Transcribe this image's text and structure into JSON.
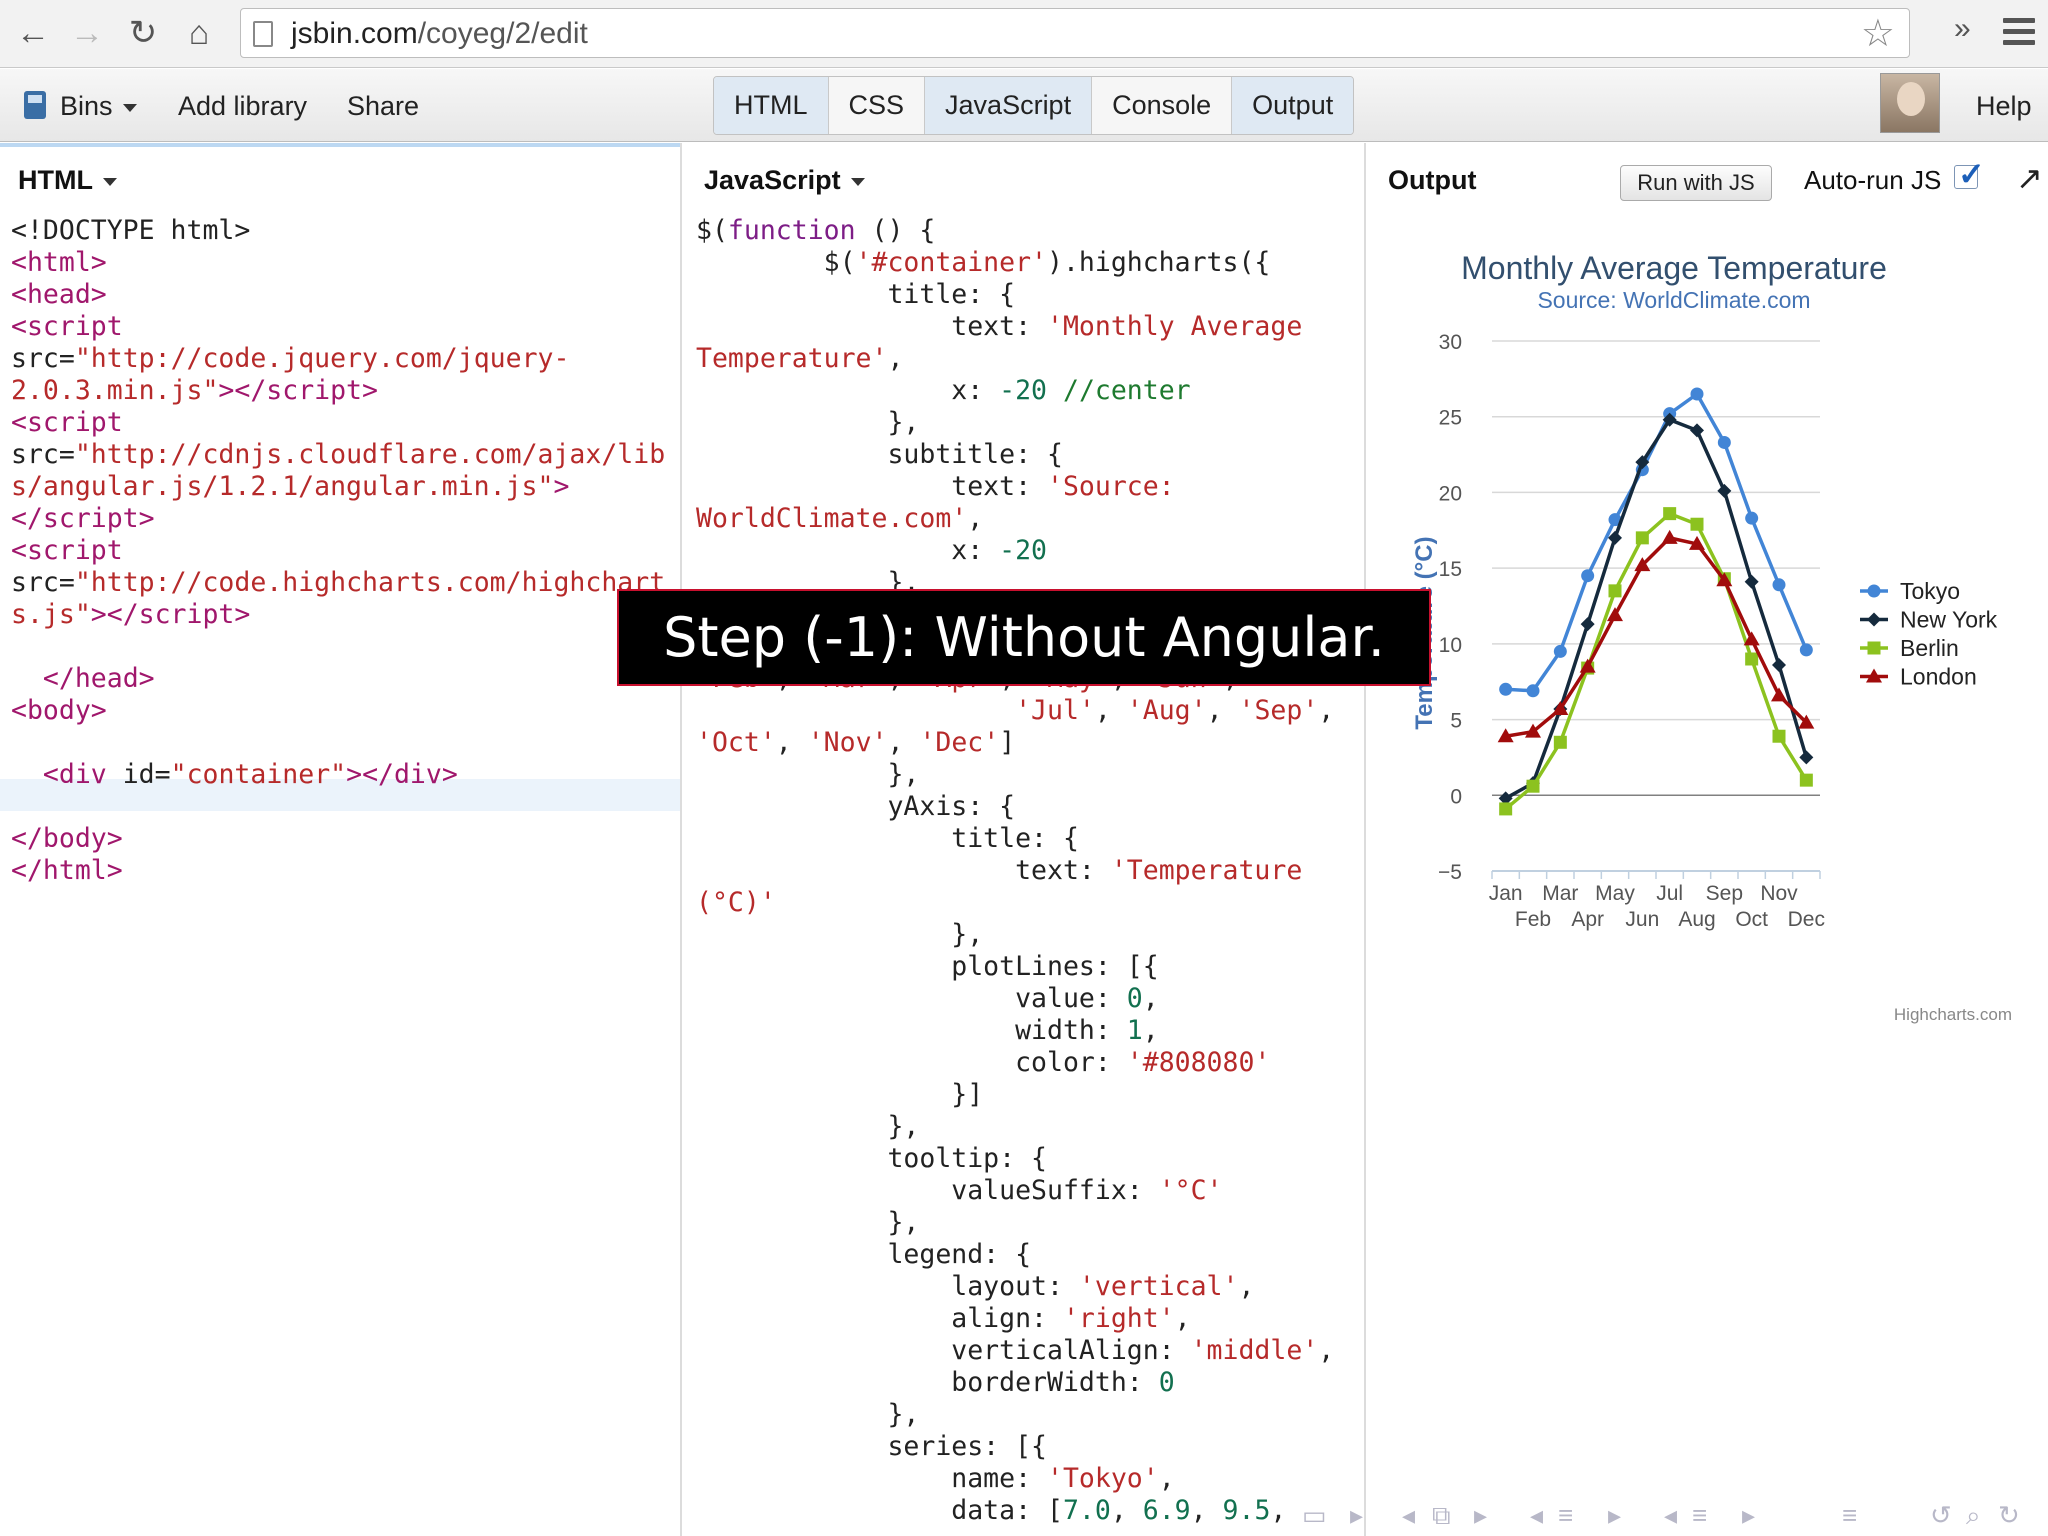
{
  "browser": {
    "back_icon": "←",
    "forward_icon": "→",
    "reload_icon": "↻",
    "home_icon": "⌂",
    "url_host": "jsbin.com",
    "url_path": "/coyeg/2/edit",
    "bookmark_icon": "☆",
    "overflow_icon": "»"
  },
  "toolbar": {
    "bins_label": "Bins",
    "add_library_label": "Add library",
    "share_label": "Share",
    "tabs": [
      "HTML",
      "CSS",
      "JavaScript",
      "Console",
      "Output"
    ],
    "help_label": "Help"
  },
  "html_panel": {
    "label": "HTML"
  },
  "js_panel": {
    "label": "JavaScript"
  },
  "output_panel": {
    "label": "Output",
    "run_button": "Run with JS",
    "autorun_label": "Auto-run JS",
    "autorun_check": "✓",
    "popout_icon": "↗"
  },
  "caption": "Step (-1): Without Angular.",
  "colors": {
    "tokyo": "#4285d6",
    "new_york": "#152a3d",
    "berlin": "#8cc21f",
    "london": "#a10c0c",
    "title": "#324f6e",
    "subtitle": "#4473b4",
    "axis_title": "#4473b4"
  },
  "chart_data": {
    "type": "line",
    "title": "Monthly Average Temperature",
    "subtitle": "Source: WorldClimate.com",
    "ylabel": "Temperature (°C)",
    "ylim": [
      -5,
      30
    ],
    "yticks": [
      -5,
      0,
      5,
      10,
      15,
      20,
      25,
      30
    ],
    "categories": [
      "Jan",
      "Feb",
      "Mar",
      "Apr",
      "May",
      "Jun",
      "Jul",
      "Aug",
      "Sep",
      "Oct",
      "Nov",
      "Dec"
    ],
    "grid": true,
    "legend_placement": "right-middle",
    "credits": "Highcharts.com",
    "series": [
      {
        "name": "Tokyo",
        "marker": "circle",
        "values": [
          7.0,
          6.9,
          9.5,
          14.5,
          18.2,
          21.5,
          25.2,
          26.5,
          23.3,
          18.3,
          13.9,
          9.6
        ]
      },
      {
        "name": "New York",
        "marker": "diamond",
        "values": [
          -0.2,
          0.8,
          5.7,
          11.3,
          17.0,
          22.0,
          24.8,
          24.1,
          20.1,
          14.1,
          8.6,
          2.5
        ]
      },
      {
        "name": "Berlin",
        "marker": "square",
        "values": [
          -0.9,
          0.6,
          3.5,
          8.4,
          13.5,
          17.0,
          18.6,
          17.9,
          14.3,
          9.0,
          3.9,
          1.0
        ]
      },
      {
        "name": "London",
        "marker": "triangle",
        "values": [
          3.9,
          4.2,
          5.7,
          8.5,
          11.9,
          15.2,
          17.0,
          16.6,
          14.2,
          10.3,
          6.6,
          4.8
        ]
      }
    ]
  }
}
